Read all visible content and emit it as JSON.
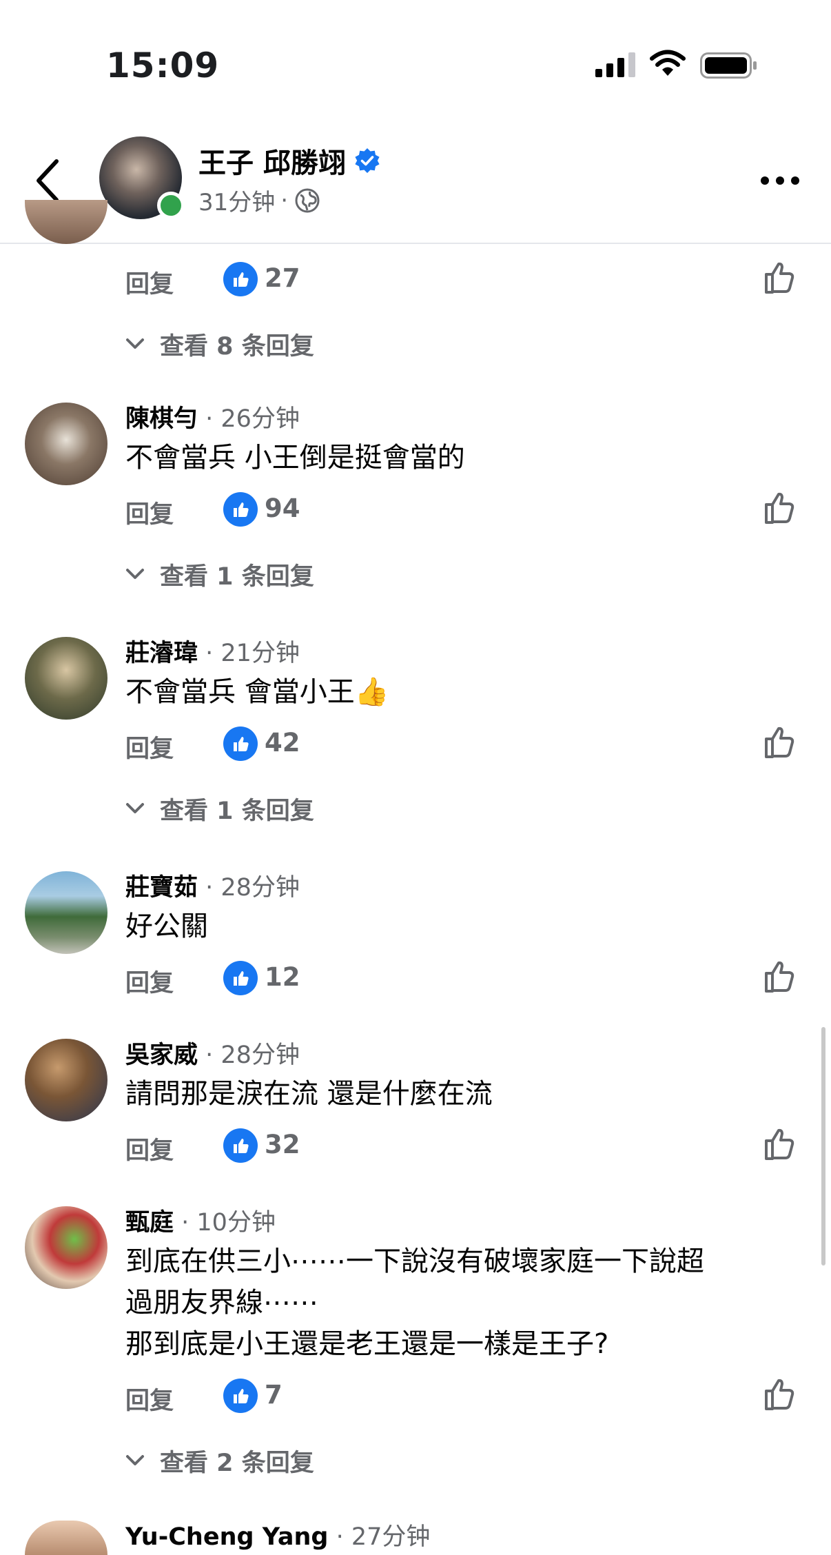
{
  "status_bar": {
    "time": "15:09"
  },
  "header": {
    "page_name": "王子 邱勝翊",
    "post_time": "31分钟",
    "separator": "·"
  },
  "reply_label": "回复",
  "comments": [
    {
      "author": "",
      "time": "",
      "text": "",
      "likes": "27",
      "view_replies": "查看 8 条回复"
    },
    {
      "author": "陳棋勻",
      "time": "· 26分钟",
      "text": "不會當兵 小王倒是挺會當的",
      "likes": "94",
      "view_replies": "查看 1 条回复"
    },
    {
      "author": "莊濬瑋",
      "time": "· 21分钟",
      "text": "不會當兵 會當小王👍",
      "likes": "42",
      "view_replies": "查看 1 条回复"
    },
    {
      "author": "莊寶茹",
      "time": "· 28分钟",
      "text": "好公關",
      "likes": "12"
    },
    {
      "author": "吳家威",
      "time": "· 28分钟",
      "text": "請問那是淚在流 還是什麼在流",
      "likes": "32"
    },
    {
      "author": "甄庭",
      "time": "· 10分钟",
      "text_lines": [
        "到底在供三小⋯⋯一下說沒有破壞家庭一下說超",
        "過朋友界線⋯⋯",
        "那到底是小王還是老王還是一樣是王子?"
      ],
      "likes": "7",
      "view_replies": "查看 2 条回复"
    },
    {
      "author": "Yu-Cheng Yang",
      "time": "· 27分钟"
    }
  ],
  "colors": {
    "like_blue": "#1877f2",
    "online_green": "#31a24c",
    "secondary_text": "#65676b"
  }
}
